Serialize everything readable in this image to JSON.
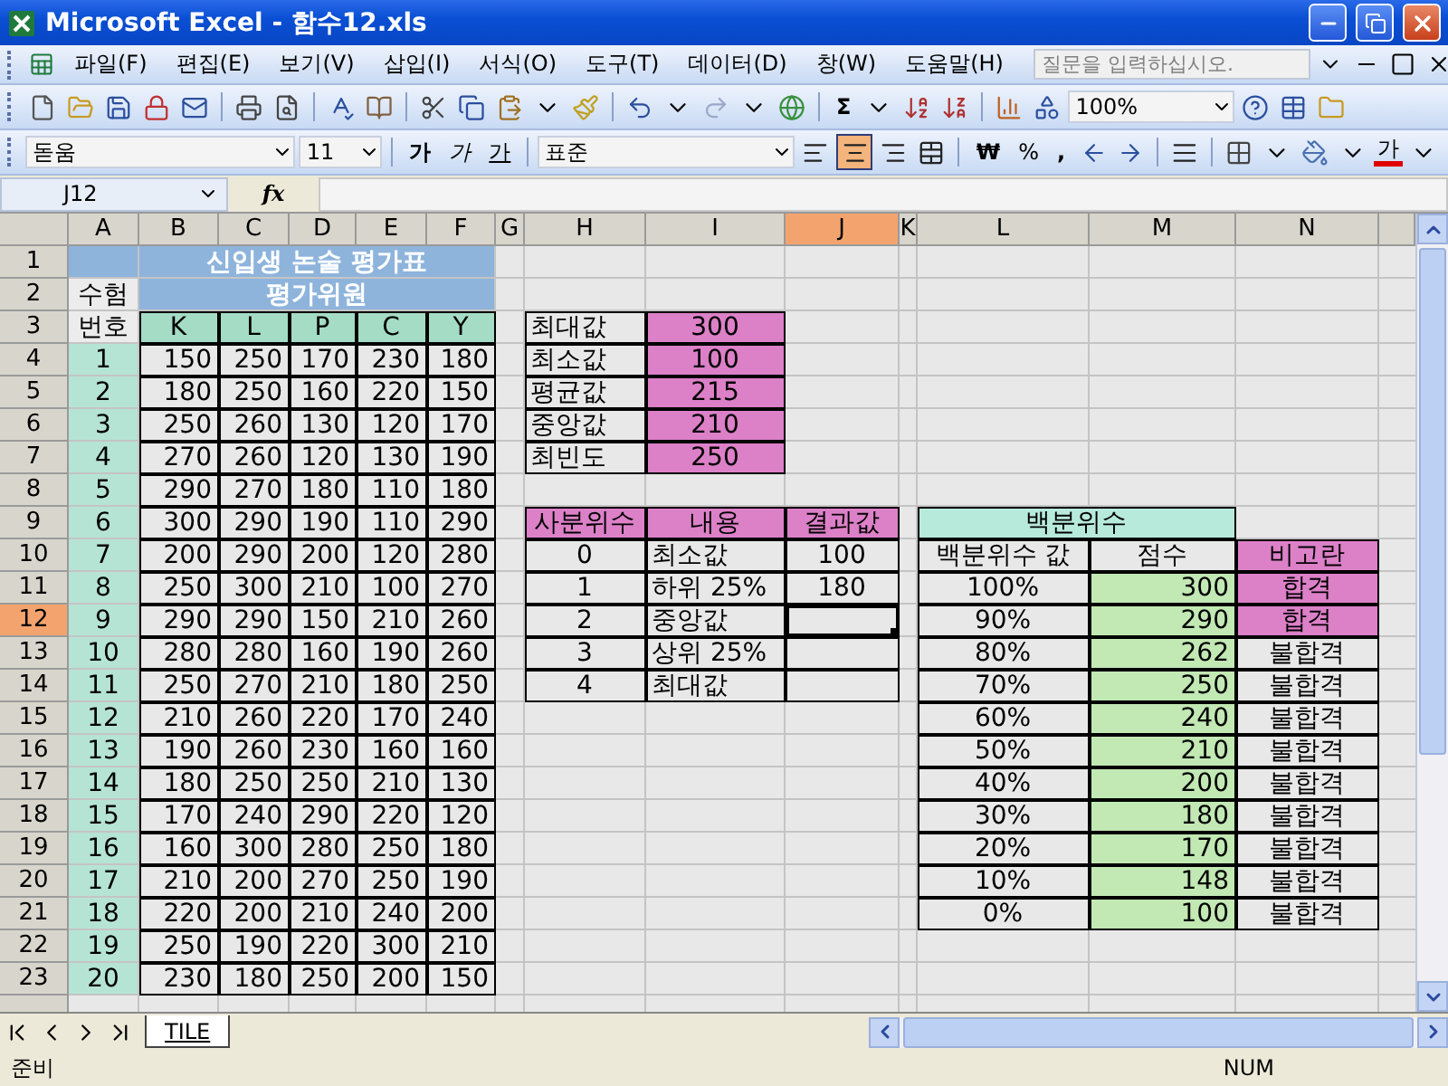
{
  "window": {
    "title": "Microsoft Excel - 함수12.xls"
  },
  "menu_bar": {
    "items": [
      "파일(F)",
      "편집(E)",
      "보기(V)",
      "삽입(I)",
      "서식(O)",
      "도구(T)",
      "데이터(D)",
      "창(W)",
      "도움말(H)"
    ],
    "help_search": {
      "placeholder": "질문을 입력하십시오."
    }
  },
  "standard_toolbar": {
    "sum": "Σ",
    "zoom": "100%"
  },
  "formatting_toolbar": {
    "font": "돋움",
    "size": "11",
    "bold": "가",
    "italic": "가",
    "underline": "가",
    "style": "표준",
    "align": [
      {
        "selected": false
      },
      {
        "selected": true
      },
      {
        "selected": false
      },
      {
        "selected": false
      }
    ],
    "currency": "₩",
    "percent": "%",
    "comma": ",",
    "font_color": "가"
  },
  "formula_bar": {
    "name_box": "J12",
    "fx": "fx"
  },
  "sheet": {
    "columns": [
      {
        "label": "A",
        "selected": false
      },
      {
        "label": "B",
        "selected": false
      },
      {
        "label": "C",
        "selected": false
      },
      {
        "label": "D",
        "selected": false
      },
      {
        "label": "E",
        "selected": false
      },
      {
        "label": "F",
        "selected": false
      },
      {
        "label": "G",
        "selected": false
      },
      {
        "label": "H",
        "selected": false
      },
      {
        "label": "I",
        "selected": false
      },
      {
        "label": "J",
        "selected": true
      },
      {
        "label": "K",
        "selected": false
      },
      {
        "label": "L",
        "selected": false
      },
      {
        "label": "M",
        "selected": false
      },
      {
        "label": "N",
        "selected": false
      }
    ],
    "rows": [
      {
        "label": "1",
        "selected": false,
        "cells": [
          {
            "kind": "band"
          },
          {
            "text": "신입생 논술 평가표",
            "kind": "title"
          },
          {
            "kind": "merged"
          },
          {
            "kind": "merged"
          },
          {
            "kind": "merged"
          },
          {
            "kind": "merged"
          }
        ]
      },
      {
        "label": "2",
        "selected": false,
        "cells": [
          {
            "text": "수험",
            "kind": "idhead"
          },
          {
            "text": "평가위원",
            "kind": "band"
          },
          {
            "kind": "merged"
          },
          {
            "kind": "merged"
          },
          {
            "kind": "merged"
          },
          {
            "kind": "merged"
          }
        ]
      },
      {
        "label": "3",
        "selected": false,
        "cells": [
          {
            "text": "번호",
            "kind": "idhead"
          },
          {
            "text": "K",
            "kind": "head"
          },
          {
            "text": "L",
            "kind": "head"
          },
          {
            "text": "P",
            "kind": "head"
          },
          {
            "text": "C",
            "kind": "head"
          },
          {
            "text": "Y",
            "kind": "head"
          },
          {
            "kind": "empty"
          },
          {
            "text": "최대값",
            "kind": "label"
          },
          {
            "text": "300",
            "kind": "pink"
          }
        ]
      },
      {
        "label": "4",
        "selected": false,
        "cells": [
          {
            "text": "1",
            "kind": "id"
          },
          {
            "text": "150",
            "kind": "num"
          },
          {
            "text": "250",
            "kind": "num"
          },
          {
            "text": "170",
            "kind": "num"
          },
          {
            "text": "230",
            "kind": "num"
          },
          {
            "text": "180",
            "kind": "num"
          },
          {
            "kind": "empty"
          },
          {
            "text": "최소값",
            "kind": "label"
          },
          {
            "text": "100",
            "kind": "pink"
          }
        ]
      },
      {
        "label": "5",
        "selected": false,
        "cells": [
          {
            "text": "2",
            "kind": "id"
          },
          {
            "text": "180",
            "kind": "num"
          },
          {
            "text": "250",
            "kind": "num"
          },
          {
            "text": "160",
            "kind": "num"
          },
          {
            "text": "220",
            "kind": "num"
          },
          {
            "text": "150",
            "kind": "num"
          },
          {
            "kind": "empty"
          },
          {
            "text": "평균값",
            "kind": "label"
          },
          {
            "text": "215",
            "kind": "pink"
          }
        ]
      },
      {
        "label": "6",
        "selected": false,
        "cells": [
          {
            "text": "3",
            "kind": "id"
          },
          {
            "text": "250",
            "kind": "num"
          },
          {
            "text": "260",
            "kind": "num"
          },
          {
            "text": "130",
            "kind": "num"
          },
          {
            "text": "120",
            "kind": "num"
          },
          {
            "text": "170",
            "kind": "num"
          },
          {
            "kind": "empty"
          },
          {
            "text": "중앙값",
            "kind": "label"
          },
          {
            "text": "210",
            "kind": "pink"
          }
        ]
      },
      {
        "label": "7",
        "selected": false,
        "cells": [
          {
            "text": "4",
            "kind": "id"
          },
          {
            "text": "270",
            "kind": "num"
          },
          {
            "text": "260",
            "kind": "num"
          },
          {
            "text": "120",
            "kind": "num"
          },
          {
            "text": "130",
            "kind": "num"
          },
          {
            "text": "190",
            "kind": "num"
          },
          {
            "kind": "empty"
          },
          {
            "text": "최빈도",
            "kind": "label"
          },
          {
            "text": "250",
            "kind": "pink"
          }
        ]
      },
      {
        "label": "8",
        "selected": false,
        "cells": [
          {
            "text": "5",
            "kind": "id"
          },
          {
            "text": "290",
            "kind": "num"
          },
          {
            "text": "270",
            "kind": "num"
          },
          {
            "text": "180",
            "kind": "num"
          },
          {
            "text": "110",
            "kind": "num"
          },
          {
            "text": "180",
            "kind": "num"
          }
        ]
      },
      {
        "label": "9",
        "selected": false,
        "cells": [
          {
            "text": "6",
            "kind": "id"
          },
          {
            "text": "300",
            "kind": "num"
          },
          {
            "text": "290",
            "kind": "num"
          },
          {
            "text": "190",
            "kind": "num"
          },
          {
            "text": "110",
            "kind": "num"
          },
          {
            "text": "290",
            "kind": "num"
          },
          {
            "kind": "empty"
          },
          {
            "text": "사분위수",
            "kind": "pink"
          },
          {
            "text": "내용",
            "kind": "pink"
          },
          {
            "text": "결과값",
            "kind": "pink"
          },
          {
            "kind": "empty"
          },
          {
            "text": "백분위수",
            "kind": "greenhead"
          },
          {
            "kind": "merged"
          }
        ]
      },
      {
        "label": "10",
        "selected": false,
        "cells": [
          {
            "text": "7",
            "kind": "id"
          },
          {
            "text": "200",
            "kind": "num"
          },
          {
            "text": "290",
            "kind": "num"
          },
          {
            "text": "200",
            "kind": "num"
          },
          {
            "text": "120",
            "kind": "num"
          },
          {
            "text": "280",
            "kind": "num"
          },
          {
            "kind": "empty"
          },
          {
            "text": "0",
            "kind": "center"
          },
          {
            "text": "최소값",
            "kind": "label"
          },
          {
            "text": "100",
            "kind": "center"
          },
          {
            "kind": "empty"
          },
          {
            "text": "백분위수 값",
            "kind": "center"
          },
          {
            "text": "점수",
            "kind": "center"
          },
          {
            "text": "비고란",
            "kind": "pink"
          }
        ]
      },
      {
        "label": "11",
        "selected": false,
        "cells": [
          {
            "text": "8",
            "kind": "id"
          },
          {
            "text": "250",
            "kind": "num"
          },
          {
            "text": "300",
            "kind": "num"
          },
          {
            "text": "210",
            "kind": "num"
          },
          {
            "text": "100",
            "kind": "num"
          },
          {
            "text": "270",
            "kind": "num"
          },
          {
            "kind": "empty"
          },
          {
            "text": "1",
            "kind": "center"
          },
          {
            "text": "하위 25%",
            "kind": "label"
          },
          {
            "text": "180",
            "kind": "center"
          },
          {
            "kind": "empty"
          },
          {
            "text": "100%",
            "kind": "center"
          },
          {
            "text": "300",
            "kind": "green"
          },
          {
            "text": "합격",
            "kind": "pink"
          }
        ]
      },
      {
        "label": "12",
        "selected": true,
        "cells": [
          {
            "text": "9",
            "kind": "id"
          },
          {
            "text": "290",
            "kind": "num"
          },
          {
            "text": "290",
            "kind": "num"
          },
          {
            "text": "150",
            "kind": "num"
          },
          {
            "text": "210",
            "kind": "num"
          },
          {
            "text": "260",
            "kind": "num"
          },
          {
            "kind": "empty"
          },
          {
            "text": "2",
            "kind": "center"
          },
          {
            "text": "중앙값",
            "kind": "label"
          },
          {
            "kind": "active"
          },
          {
            "kind": "empty"
          },
          {
            "text": "90%",
            "kind": "center"
          },
          {
            "text": "290",
            "kind": "green"
          },
          {
            "text": "합격",
            "kind": "pink"
          }
        ]
      },
      {
        "label": "13",
        "selected": false,
        "cells": [
          {
            "text": "10",
            "kind": "id"
          },
          {
            "text": "280",
            "kind": "num"
          },
          {
            "text": "280",
            "kind": "num"
          },
          {
            "text": "160",
            "kind": "num"
          },
          {
            "text": "190",
            "kind": "num"
          },
          {
            "text": "260",
            "kind": "num"
          },
          {
            "kind": "empty"
          },
          {
            "text": "3",
            "kind": "center"
          },
          {
            "text": "상위 25%",
            "kind": "label"
          },
          {
            "kind": "box"
          },
          {
            "kind": "empty"
          },
          {
            "text": "80%",
            "kind": "center"
          },
          {
            "text": "262",
            "kind": "green"
          },
          {
            "text": "불합격",
            "kind": "center"
          }
        ]
      },
      {
        "label": "14",
        "selected": false,
        "cells": [
          {
            "text": "11",
            "kind": "id"
          },
          {
            "text": "250",
            "kind": "num"
          },
          {
            "text": "270",
            "kind": "num"
          },
          {
            "text": "210",
            "kind": "num"
          },
          {
            "text": "180",
            "kind": "num"
          },
          {
            "text": "250",
            "kind": "num"
          },
          {
            "kind": "empty"
          },
          {
            "text": "4",
            "kind": "center"
          },
          {
            "text": "최대값",
            "kind": "label"
          },
          {
            "kind": "box"
          },
          {
            "kind": "empty"
          },
          {
            "text": "70%",
            "kind": "center"
          },
          {
            "text": "250",
            "kind": "green"
          },
          {
            "text": "불합격",
            "kind": "center"
          }
        ]
      },
      {
        "label": "15",
        "selected": false,
        "cells": [
          {
            "text": "12",
            "kind": "id"
          },
          {
            "text": "210",
            "kind": "num"
          },
          {
            "text": "260",
            "kind": "num"
          },
          {
            "text": "220",
            "kind": "num"
          },
          {
            "text": "170",
            "kind": "num"
          },
          {
            "text": "240",
            "kind": "num"
          },
          {
            "kind": "empty"
          },
          {
            "kind": "empty"
          },
          {
            "kind": "empty"
          },
          {
            "kind": "empty"
          },
          {
            "kind": "empty"
          },
          {
            "text": "60%",
            "kind": "center"
          },
          {
            "text": "240",
            "kind": "green"
          },
          {
            "text": "불합격",
            "kind": "center"
          }
        ]
      },
      {
        "label": "16",
        "selected": false,
        "cells": [
          {
            "text": "13",
            "kind": "id"
          },
          {
            "text": "190",
            "kind": "num"
          },
          {
            "text": "260",
            "kind": "num"
          },
          {
            "text": "230",
            "kind": "num"
          },
          {
            "text": "160",
            "kind": "num"
          },
          {
            "text": "160",
            "kind": "num"
          },
          {
            "kind": "empty"
          },
          {
            "kind": "empty"
          },
          {
            "kind": "empty"
          },
          {
            "kind": "empty"
          },
          {
            "kind": "empty"
          },
          {
            "text": "50%",
            "kind": "center"
          },
          {
            "text": "210",
            "kind": "green"
          },
          {
            "text": "불합격",
            "kind": "center"
          }
        ]
      },
      {
        "label": "17",
        "selected": false,
        "cells": [
          {
            "text": "14",
            "kind": "id"
          },
          {
            "text": "180",
            "kind": "num"
          },
          {
            "text": "250",
            "kind": "num"
          },
          {
            "text": "250",
            "kind": "num"
          },
          {
            "text": "210",
            "kind": "num"
          },
          {
            "text": "130",
            "kind": "num"
          },
          {
            "kind": "empty"
          },
          {
            "kind": "empty"
          },
          {
            "kind": "empty"
          },
          {
            "kind": "empty"
          },
          {
            "kind": "empty"
          },
          {
            "text": "40%",
            "kind": "center"
          },
          {
            "text": "200",
            "kind": "green"
          },
          {
            "text": "불합격",
            "kind": "center"
          }
        ]
      },
      {
        "label": "18",
        "selected": false,
        "cells": [
          {
            "text": "15",
            "kind": "id"
          },
          {
            "text": "170",
            "kind": "num"
          },
          {
            "text": "240",
            "kind": "num"
          },
          {
            "text": "290",
            "kind": "num"
          },
          {
            "text": "220",
            "kind": "num"
          },
          {
            "text": "120",
            "kind": "num"
          },
          {
            "kind": "empty"
          },
          {
            "kind": "empty"
          },
          {
            "kind": "empty"
          },
          {
            "kind": "empty"
          },
          {
            "kind": "empty"
          },
          {
            "text": "30%",
            "kind": "center"
          },
          {
            "text": "180",
            "kind": "green"
          },
          {
            "text": "불합격",
            "kind": "center"
          }
        ]
      },
      {
        "label": "19",
        "selected": false,
        "cells": [
          {
            "text": "16",
            "kind": "id"
          },
          {
            "text": "160",
            "kind": "num"
          },
          {
            "text": "300",
            "kind": "num"
          },
          {
            "text": "280",
            "kind": "num"
          },
          {
            "text": "250",
            "kind": "num"
          },
          {
            "text": "180",
            "kind": "num"
          },
          {
            "kind": "empty"
          },
          {
            "kind": "empty"
          },
          {
            "kind": "empty"
          },
          {
            "kind": "empty"
          },
          {
            "kind": "empty"
          },
          {
            "text": "20%",
            "kind": "center"
          },
          {
            "text": "170",
            "kind": "green"
          },
          {
            "text": "불합격",
            "kind": "center"
          }
        ]
      },
      {
        "label": "20",
        "selected": false,
        "cells": [
          {
            "text": "17",
            "kind": "id"
          },
          {
            "text": "210",
            "kind": "num"
          },
          {
            "text": "200",
            "kind": "num"
          },
          {
            "text": "270",
            "kind": "num"
          },
          {
            "text": "250",
            "kind": "num"
          },
          {
            "text": "190",
            "kind": "num"
          },
          {
            "kind": "empty"
          },
          {
            "kind": "empty"
          },
          {
            "kind": "empty"
          },
          {
            "kind": "empty"
          },
          {
            "kind": "empty"
          },
          {
            "text": "10%",
            "kind": "center"
          },
          {
            "text": "148",
            "kind": "green"
          },
          {
            "text": "불합격",
            "kind": "center"
          }
        ]
      },
      {
        "label": "21",
        "selected": false,
        "cells": [
          {
            "text": "18",
            "kind": "id"
          },
          {
            "text": "220",
            "kind": "num"
          },
          {
            "text": "200",
            "kind": "num"
          },
          {
            "text": "210",
            "kind": "num"
          },
          {
            "text": "240",
            "kind": "num"
          },
          {
            "text": "200",
            "kind": "num"
          },
          {
            "kind": "empty"
          },
          {
            "kind": "empty"
          },
          {
            "kind": "empty"
          },
          {
            "kind": "empty"
          },
          {
            "kind": "empty"
          },
          {
            "text": "0%",
            "kind": "center"
          },
          {
            "text": "100",
            "kind": "green"
          },
          {
            "text": "불합격",
            "kind": "center"
          }
        ]
      },
      {
        "label": "22",
        "selected": false,
        "cells": [
          {
            "text": "19",
            "kind": "id"
          },
          {
            "text": "250",
            "kind": "num"
          },
          {
            "text": "190",
            "kind": "num"
          },
          {
            "text": "220",
            "kind": "num"
          },
          {
            "text": "300",
            "kind": "num"
          },
          {
            "text": "210",
            "kind": "num"
          }
        ]
      },
      {
        "label": "23",
        "selected": false,
        "cells": [
          {
            "text": "20",
            "kind": "id"
          },
          {
            "text": "230",
            "kind": "num"
          },
          {
            "text": "180",
            "kind": "num"
          },
          {
            "text": "250",
            "kind": "num"
          },
          {
            "text": "200",
            "kind": "num"
          },
          {
            "text": "150",
            "kind": "num"
          }
        ]
      }
    ]
  },
  "sheet_tabs": [
    {
      "label": "TILE",
      "selected": true
    }
  ],
  "status_bar": {
    "mode": "준비",
    "num": "NUM"
  }
}
